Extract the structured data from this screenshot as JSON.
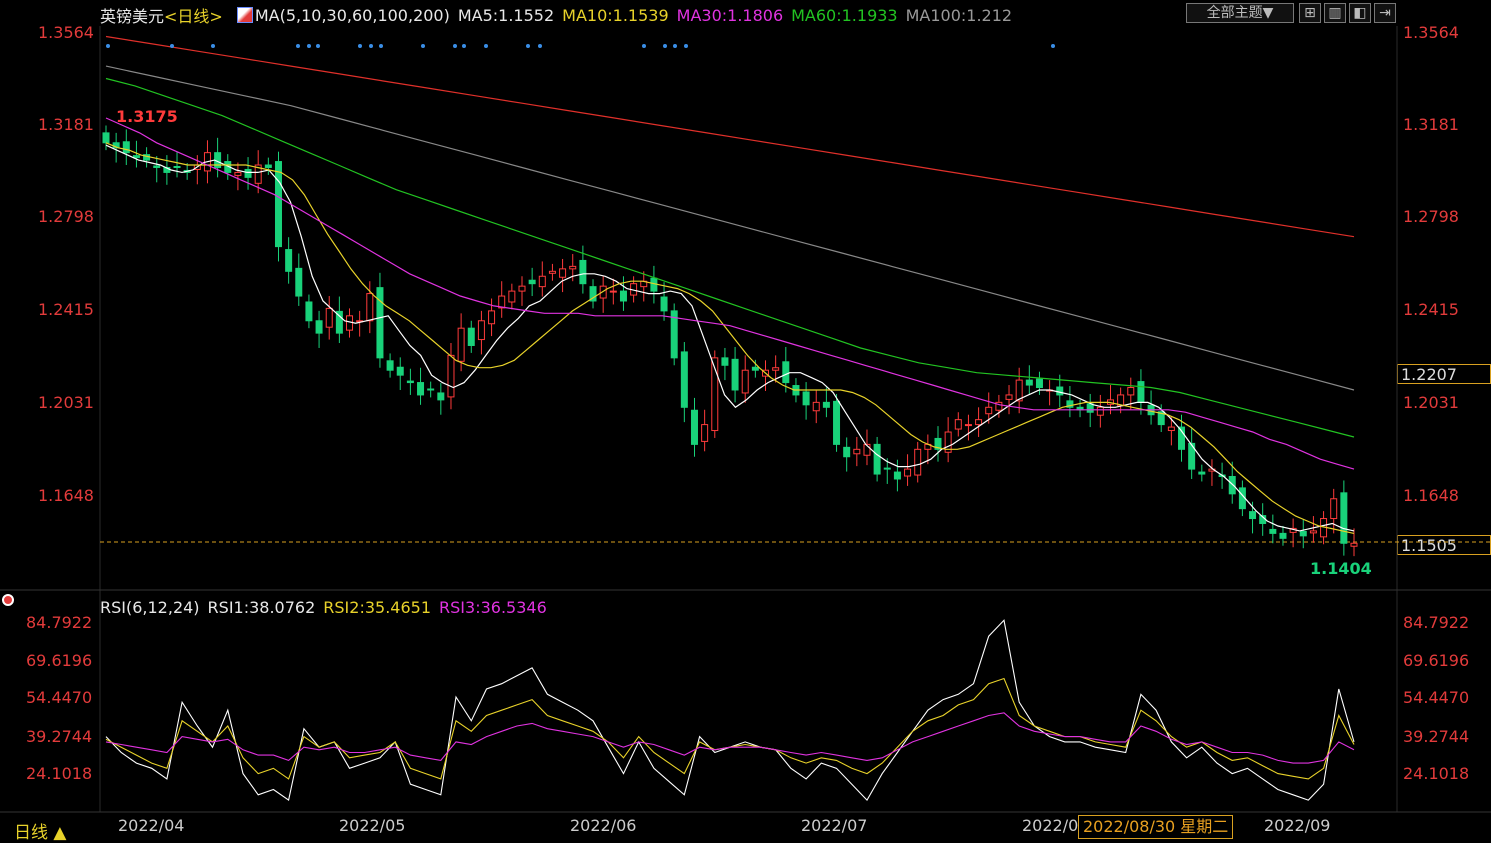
{
  "header": {
    "symbol": "英镑美元",
    "period": "<日线>",
    "ma_title": "MA(5,10,30,60,100,200)",
    "ma5": "MA5:1.1552",
    "ma10": "MA10:1.1539",
    "ma30": "MA30:1.1806",
    "ma60": "MA60:1.1933",
    "ma100": "MA100:1.212"
  },
  "toolbar": {
    "theme_label": "全部主题▼",
    "icons": [
      "grid-icon",
      "columns-icon",
      "layout-icon",
      "forward-icon"
    ]
  },
  "rsi_header": {
    "title": "RSI(6,12,24)",
    "rsi1": "RSI1:38.0762",
    "rsi2": "RSI2:35.4651",
    "rsi3": "RSI3:36.5346"
  },
  "price_ticks": [
    "1.3564",
    "1.3181",
    "1.2798",
    "1.2415",
    "1.2031",
    "1.1648"
  ],
  "rsi_ticks": [
    "84.7922",
    "69.6196",
    "54.4470",
    "39.2744",
    "24.1018"
  ],
  "markers": {
    "high": "1.3175",
    "low": "1.1404",
    "current_price": "1.1505",
    "cursor_price": "1.2207"
  },
  "footer": {
    "period_label": "日线 ▲",
    "dates": [
      "2022/04",
      "2022/05",
      "2022/06",
      "2022/07",
      "2022/0",
      "2022/09"
    ],
    "cursor_date": "2022/08/30 星期二"
  },
  "colors": {
    "up": "#ff3b3b",
    "down": "#19d27a",
    "ma5": "#ffffff",
    "ma10": "#e8d22a",
    "ma30": "#e033e0",
    "ma60": "#22c322",
    "ma100": "#888888",
    "ma200": "#e0302a"
  },
  "chart_data": [
    {
      "type": "candlestick",
      "title": "英镑美元 日线",
      "x_range": [
        "2022-04",
        "2022-09"
      ],
      "ylim": [
        1.1404,
        1.3564
      ],
      "extremes": {
        "high": 1.3175,
        "low": 1.1404,
        "last": 1.1505
      },
      "ohlc_close_approx": [
        1.312,
        1.31,
        1.308,
        1.306,
        1.305,
        1.302,
        1.3,
        1.302,
        1.3,
        1.303,
        1.308,
        1.302,
        1.3,
        1.3,
        1.298,
        1.303,
        1.302,
        1.27,
        1.26,
        1.25,
        1.24,
        1.235,
        1.245,
        1.235,
        1.242,
        1.24,
        1.251,
        1.225,
        1.22,
        1.218,
        1.215,
        1.21,
        1.212,
        1.208,
        1.226,
        1.237,
        1.23,
        1.24,
        1.244,
        1.25,
        1.252,
        1.254,
        1.255,
        1.258,
        1.26,
        1.261,
        1.262,
        1.255,
        1.248,
        1.254,
        1.252,
        1.248,
        1.255,
        1.256,
        1.252,
        1.244,
        1.225,
        1.205,
        1.19,
        1.198,
        1.225,
        1.222,
        1.212,
        1.22,
        1.22,
        1.22,
        1.221,
        1.215,
        1.21,
        1.206,
        1.207,
        1.205,
        1.19,
        1.185,
        1.188,
        1.19,
        1.178,
        1.18,
        1.176,
        1.18,
        1.188,
        1.19,
        1.188,
        1.195,
        1.2,
        1.198,
        1.2,
        1.205,
        1.207,
        1.21,
        1.216,
        1.214,
        1.213,
        1.212,
        1.21,
        1.205,
        1.204,
        1.203,
        1.205,
        1.208,
        1.21,
        1.213,
        1.207,
        1.202,
        1.198,
        1.197,
        1.188,
        1.18,
        1.178,
        1.18,
        1.177,
        1.17,
        1.164,
        1.16,
        1.158,
        1.154,
        1.152,
        1.156,
        1.153,
        1.155,
        1.16,
        1.168,
        1.15,
        1.15
      ],
      "series": [
        {
          "name": "MA5",
          "values": [
            1.311,
            1.309,
            1.307,
            1.305,
            1.304,
            1.303,
            1.301,
            1.3,
            1.301,
            1.304,
            1.305,
            1.303,
            1.301,
            1.3,
            1.3,
            1.301,
            1.296,
            1.288,
            1.274,
            1.258,
            1.248,
            1.244,
            1.24,
            1.239,
            1.24,
            1.241,
            1.242,
            1.236,
            1.23,
            1.226,
            1.218,
            1.215,
            1.213,
            1.215,
            1.22,
            1.226,
            1.232,
            1.237,
            1.241,
            1.246,
            1.248,
            1.252,
            1.256,
            1.258,
            1.259,
            1.259,
            1.258,
            1.256,
            1.253,
            1.252,
            1.251,
            1.251,
            1.252,
            1.251,
            1.246,
            1.234,
            1.222,
            1.21,
            1.205,
            1.208,
            1.212,
            1.215,
            1.217,
            1.219,
            1.219,
            1.217,
            1.215,
            1.211,
            1.204,
            1.197,
            1.19,
            1.186,
            1.183,
            1.181,
            1.181,
            1.182,
            1.184,
            1.188,
            1.19,
            1.193,
            1.196,
            1.199,
            1.202,
            1.205,
            1.208,
            1.21,
            1.212,
            1.212,
            1.211,
            1.21,
            1.208,
            1.206,
            1.205,
            1.205,
            1.206,
            1.207,
            1.207,
            1.205,
            1.201,
            1.196,
            1.19,
            1.184,
            1.18,
            1.177,
            1.173,
            1.168,
            1.163,
            1.159,
            1.157,
            1.156,
            1.155,
            1.156,
            1.157,
            1.158,
            1.156,
            1.155
          ]
        },
        {
          "name": "MA10",
          "values": [
            1.312,
            1.31,
            1.309,
            1.307,
            1.306,
            1.305,
            1.304,
            1.303,
            1.303,
            1.303,
            1.303,
            1.303,
            1.303,
            1.302,
            1.301,
            1.3,
            1.297,
            1.291,
            1.283,
            1.275,
            1.268,
            1.261,
            1.255,
            1.25,
            1.246,
            1.243,
            1.24,
            1.236,
            1.232,
            1.228,
            1.224,
            1.222,
            1.221,
            1.221,
            1.222,
            1.224,
            1.228,
            1.232,
            1.236,
            1.24,
            1.244,
            1.247,
            1.25,
            1.253,
            1.255,
            1.256,
            1.256,
            1.255,
            1.254,
            1.253,
            1.251,
            1.248,
            1.244,
            1.238,
            1.232,
            1.226,
            1.221,
            1.217,
            1.214,
            1.212,
            1.212,
            1.212,
            1.212,
            1.212,
            1.211,
            1.209,
            1.206,
            1.202,
            1.198,
            1.194,
            1.191,
            1.189,
            1.188,
            1.188,
            1.189,
            1.191,
            1.193,
            1.195,
            1.197,
            1.199,
            1.201,
            1.203,
            1.205,
            1.206,
            1.207,
            1.207,
            1.207,
            1.206,
            1.205,
            1.204,
            1.203,
            1.202,
            1.2,
            1.197,
            1.193,
            1.189,
            1.184,
            1.179,
            1.175,
            1.171,
            1.167,
            1.164,
            1.161,
            1.159,
            1.157,
            1.156,
            1.155,
            1.154
          ]
        },
        {
          "name": "MA30",
          "values": [
            1.322,
            1.319,
            1.316,
            1.312,
            1.309,
            1.306,
            1.303,
            1.3,
            1.297,
            1.294,
            1.291,
            1.287,
            1.283,
            1.279,
            1.275,
            1.271,
            1.267,
            1.263,
            1.259,
            1.256,
            1.253,
            1.25,
            1.248,
            1.246,
            1.245,
            1.244,
            1.243,
            1.243,
            1.243,
            1.242,
            1.242,
            1.242,
            1.242,
            1.242,
            1.241,
            1.24,
            1.239,
            1.238,
            1.236,
            1.234,
            1.232,
            1.23,
            1.228,
            1.226,
            1.224,
            1.222,
            1.22,
            1.218,
            1.216,
            1.214,
            1.212,
            1.21,
            1.208,
            1.206,
            1.205,
            1.204,
            1.204,
            1.204,
            1.204,
            1.204,
            1.204,
            1.204,
            1.204,
            1.204,
            1.203,
            1.201,
            1.199,
            1.197,
            1.195,
            1.192,
            1.19,
            1.187,
            1.184,
            1.182,
            1.18
          ]
        },
        {
          "name": "MA60",
          "values": [
            1.338,
            1.335,
            1.331,
            1.327,
            1.323,
            1.318,
            1.313,
            1.308,
            1.303,
            1.298,
            1.293,
            1.289,
            1.285,
            1.281,
            1.277,
            1.273,
            1.269,
            1.265,
            1.261,
            1.257,
            1.253,
            1.249,
            1.245,
            1.241,
            1.237,
            1.233,
            1.229,
            1.226,
            1.223,
            1.221,
            1.219,
            1.218,
            1.217,
            1.216,
            1.215,
            1.214,
            1.213,
            1.211,
            1.208,
            1.205,
            1.202,
            1.199,
            1.196,
            1.193
          ]
        },
        {
          "name": "MA100",
          "values": [
            1.343,
            1.339,
            1.335,
            1.331,
            1.327,
            1.322,
            1.317,
            1.312,
            1.307,
            1.302,
            1.297,
            1.292,
            1.287,
            1.282,
            1.277,
            1.272,
            1.267,
            1.262,
            1.257,
            1.252,
            1.247,
            1.242,
            1.237,
            1.232,
            1.227,
            1.222,
            1.217,
            1.212
          ]
        },
        {
          "name": "MA200",
          "values": [
            1.355,
            1.352,
            1.349,
            1.346,
            1.343,
            1.34,
            1.337,
            1.334,
            1.331,
            1.328,
            1.325,
            1.322,
            1.319,
            1.316,
            1.313,
            1.31,
            1.307,
            1.304,
            1.301,
            1.298,
            1.295,
            1.292,
            1.289,
            1.286,
            1.283,
            1.28,
            1.277,
            1.274
          ]
        }
      ]
    },
    {
      "type": "line",
      "title": "RSI(6,12,24)",
      "ylim": [
        15,
        88
      ],
      "series": [
        {
          "name": "RSI1",
          "values": [
            42,
            36,
            32,
            30,
            26,
            55,
            46,
            38,
            52,
            28,
            20,
            22,
            18,
            45,
            38,
            40,
            30,
            32,
            34,
            40,
            24,
            22,
            20,
            57,
            48,
            60,
            62,
            65,
            68,
            58,
            55,
            52,
            48,
            38,
            28,
            40,
            30,
            25,
            20,
            42,
            36,
            38,
            40,
            38,
            37,
            30,
            26,
            32,
            30,
            24,
            18,
            28,
            36,
            44,
            52,
            56,
            58,
            62,
            80,
            86,
            55,
            46,
            42,
            40,
            40,
            38,
            37,
            36,
            58,
            52,
            40,
            34,
            38,
            32,
            28,
            30,
            26,
            22,
            20,
            18,
            24,
            60,
            40
          ]
        },
        {
          "name": "RSI2",
          "values": [
            41,
            38,
            35,
            32,
            30,
            48,
            44,
            40,
            46,
            34,
            28,
            30,
            26,
            42,
            38,
            40,
            34,
            35,
            36,
            40,
            30,
            28,
            26,
            48,
            44,
            50,
            52,
            54,
            56,
            50,
            48,
            46,
            44,
            40,
            34,
            42,
            36,
            32,
            28,
            40,
            37,
            38,
            39,
            38,
            37,
            34,
            32,
            34,
            33,
            30,
            28,
            32,
            38,
            44,
            48,
            50,
            54,
            56,
            62,
            64,
            50,
            46,
            44,
            42,
            42,
            40,
            39,
            38,
            52,
            48,
            42,
            38,
            40,
            36,
            33,
            34,
            31,
            28,
            27,
            26,
            30,
            50,
            39
          ]
        },
        {
          "name": "RSI3",
          "values": [
            40,
            39,
            38,
            37,
            36,
            42,
            41,
            40,
            41,
            37,
            35,
            35,
            33,
            38,
            37,
            38,
            36,
            36,
            37,
            38,
            35,
            34,
            33,
            40,
            39,
            42,
            44,
            46,
            47,
            45,
            44,
            43,
            42,
            40,
            38,
            40,
            39,
            37,
            35,
            38,
            37,
            38,
            38,
            38,
            37,
            36,
            35,
            36,
            35,
            34,
            33,
            34,
            37,
            40,
            42,
            44,
            46,
            48,
            50,
            51,
            46,
            44,
            43,
            42,
            42,
            41,
            40,
            40,
            46,
            44,
            41,
            39,
            40,
            38,
            36,
            36,
            35,
            33,
            32,
            32,
            33,
            40,
            37
          ]
        }
      ]
    }
  ]
}
